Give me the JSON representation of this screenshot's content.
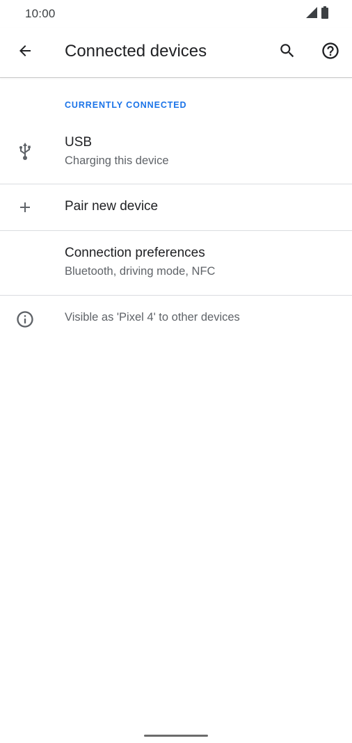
{
  "status_bar": {
    "time": "10:00",
    "icons": [
      "signal-icon",
      "battery-icon"
    ]
  },
  "app_bar": {
    "title": "Connected devices",
    "back_icon": "arrow-back-icon",
    "search_icon": "search-icon",
    "help_icon": "help-circle-icon"
  },
  "sections": {
    "currently_connected": {
      "header": "CURRENTLY CONNECTED",
      "items": [
        {
          "icon": "usb-icon",
          "title": "USB",
          "subtitle": "Charging this device"
        }
      ]
    }
  },
  "pair_new_device": {
    "icon": "add-icon",
    "label": "Pair new device"
  },
  "connection_preferences": {
    "title": "Connection preferences",
    "subtitle": "Bluetooth, driving mode, NFC"
  },
  "footer_info": {
    "icon": "info-icon",
    "text": "Visible as 'Pixel 4' to other devices"
  },
  "colors": {
    "accent": "#1a73e8",
    "icon": "#5f6368",
    "divider": "#dadce0",
    "text_primary": "#202124",
    "text_secondary": "#5f6368"
  }
}
